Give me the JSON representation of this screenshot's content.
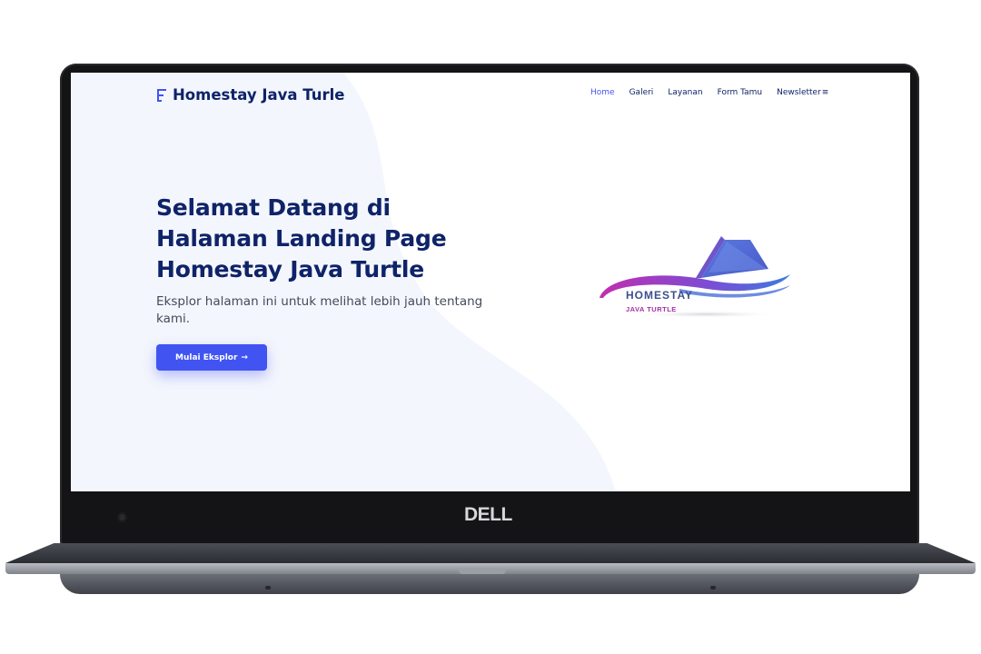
{
  "device": {
    "brand": "DELL"
  },
  "site": {
    "logo_text": "Homestay Java Turle",
    "nav": [
      {
        "label": "Home",
        "active": true
      },
      {
        "label": "Galeri",
        "active": false
      },
      {
        "label": "Layanan",
        "active": false
      },
      {
        "label": "Form Tamu",
        "active": false
      },
      {
        "label": "Newsletter",
        "active": false
      }
    ],
    "menu_glyph": "≡"
  },
  "hero": {
    "title": "Selamat Datang di Halaman Landing Page Homestay Java Turtle",
    "subtitle": "Eksplor halaman ini untuk melihat lebih jauh tentang kami.",
    "cta_label": "Mulai Eksplor",
    "cta_arrow": "→",
    "logo_line1": "HOMESTAY",
    "logo_line2": "JAVA TURTLE"
  },
  "colors": {
    "primary": "#4154f1",
    "heading": "#0e2368",
    "background": "#f4f6fd",
    "logo_purple": "#a72fa8",
    "logo_blue": "#4c63d2"
  }
}
